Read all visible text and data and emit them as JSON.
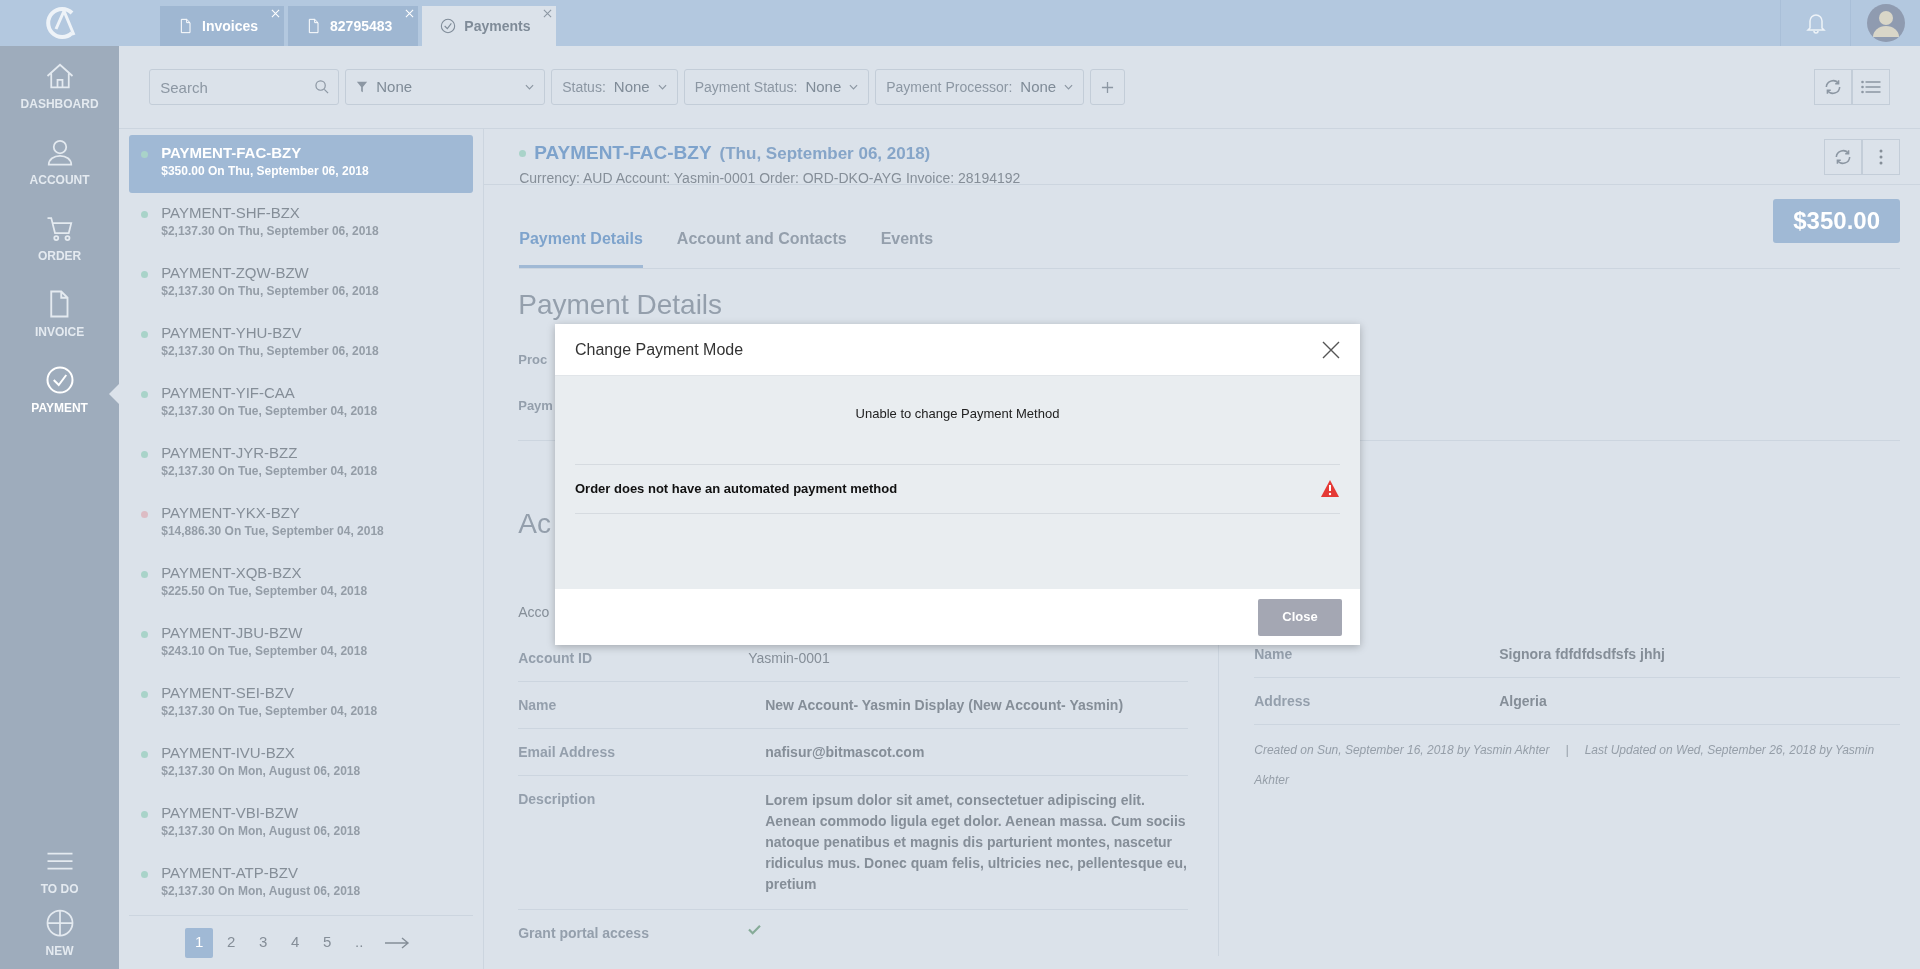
{
  "top_tabs": [
    {
      "label": "Invoices",
      "selected": false
    },
    {
      "label": "82795483",
      "selected": false
    },
    {
      "label": "Payments",
      "selected": true
    }
  ],
  "sidebar": {
    "items": [
      {
        "label": "DASHBOARD",
        "selected": false
      },
      {
        "label": "ACCOUNT",
        "selected": false
      },
      {
        "label": "ORDER",
        "selected": false
      },
      {
        "label": "INVOICE",
        "selected": false
      },
      {
        "label": "PAYMENT",
        "selected": true
      }
    ],
    "bottom_items": [
      {
        "label": "TO DO"
      },
      {
        "label": "NEW"
      }
    ]
  },
  "filters": {
    "search_placeholder": "Search",
    "filter_value": "None",
    "dropdowns": [
      {
        "label": "Status:",
        "value": "None"
      },
      {
        "label": "Payment Status:",
        "value": "None"
      },
      {
        "label": "Payment Processor:",
        "value": "None"
      }
    ]
  },
  "payments": [
    {
      "name": "PAYMENT-FAC-BZY",
      "detail": "$350.00 On Thu, September 06, 2018",
      "color": "#a9d3c9",
      "selected": true
    },
    {
      "name": "PAYMENT-SHF-BZX",
      "detail": "$2,137.30 On Thu, September 06, 2018",
      "color": "#a9d3c9",
      "selected": false
    },
    {
      "name": "PAYMENT-ZQW-BZW",
      "detail": "$2,137.30 On Thu, September 06, 2018",
      "color": "#a9d3c9",
      "selected": false
    },
    {
      "name": "PAYMENT-YHU-BZV",
      "detail": "$2,137.30 On Thu, September 06, 2018",
      "color": "#a9d3c9",
      "selected": false
    },
    {
      "name": "PAYMENT-YIF-CAA",
      "detail": "$2,137.30 On Tue, September 04, 2018",
      "color": "#a9d3c9",
      "selected": false
    },
    {
      "name": "PAYMENT-JYR-BZZ",
      "detail": "$2,137.30 On Tue, September 04, 2018",
      "color": "#a9d3c9",
      "selected": false
    },
    {
      "name": "PAYMENT-YKX-BZY",
      "detail": "$14,886.30 On Tue, September 04, 2018",
      "color": "#dcbcc4",
      "selected": false
    },
    {
      "name": "PAYMENT-XQB-BZX",
      "detail": "$225.50 On Tue, September 04, 2018",
      "color": "#a9d3c9",
      "selected": false
    },
    {
      "name": "PAYMENT-JBU-BZW",
      "detail": "$243.10 On Tue, September 04, 2018",
      "color": "#a9d3c9",
      "selected": false
    },
    {
      "name": "PAYMENT-SEI-BZV",
      "detail": "$2,137.30 On Tue, September 04, 2018",
      "color": "#a9d3c9",
      "selected": false
    },
    {
      "name": "PAYMENT-IVU-BZX",
      "detail": "$2,137.30 On Mon, August 06, 2018",
      "color": "#a9d3c9",
      "selected": false
    },
    {
      "name": "PAYMENT-VBI-BZW",
      "detail": "$2,137.30 On Mon, August 06, 2018",
      "color": "#a9d3c9",
      "selected": false
    },
    {
      "name": "PAYMENT-ATP-BZV",
      "detail": "$2,137.30 On Mon, August 06, 2018",
      "color": "#a9d3c9",
      "selected": false
    }
  ],
  "pagination": {
    "pages": [
      {
        "label": "1",
        "selected": true
      },
      {
        "label": "2",
        "selected": false
      },
      {
        "label": "3",
        "selected": false
      },
      {
        "label": "4",
        "selected": false
      },
      {
        "label": "5",
        "selected": false
      },
      {
        "label": "..",
        "selected": false
      }
    ]
  },
  "detail": {
    "color": "#a9d3c9",
    "title": "PAYMENT-FAC-BZY",
    "date": "(Thu, September 06, 2018)",
    "meta": "Currency: AUD Account: Yasmin-0001 Order: ORD-DKO-AYG Invoice: 28194192",
    "tabs": [
      {
        "label": "Payment Details",
        "selected": true
      },
      {
        "label": "Account and Contacts",
        "selected": false
      },
      {
        "label": "Events",
        "selected": false
      }
    ],
    "amount": "$350.00",
    "section_title": "Payment Details",
    "section_labels": [
      "Proc",
      "Paym"
    ],
    "second_title": "Ac",
    "left_heading": "Acco",
    "left_fields": [
      {
        "label": "Account ID",
        "value": "Yasmin-0001"
      },
      {
        "label": "Name",
        "value": "New Account- Yasmin Display (New Account- Yasmin)"
      },
      {
        "label": "Email Address",
        "value": "nafisur@bitmascot.com"
      },
      {
        "label": "Description",
        "value": "Lorem ipsum dolor sit amet, consectetuer adipiscing elit. Aenean commodo ligula eget dolor. Aenean massa. Cum sociis natoque penatibus et magnis dis parturient montes, nascetur ridiculus mus. Donec quam felis, ultricies nec, pellentesque eu, pretium"
      }
    ],
    "grant_label": "Grant portal access",
    "grant_checked": true,
    "right_fields": [
      {
        "label": "Name",
        "value": "Signora fdfdfdsdfsfs jhhj"
      },
      {
        "label": "Address",
        "value": "Algeria"
      }
    ],
    "created": "Created on Sun, September 16, 2018 by Yasmin Akhter",
    "separator": "|",
    "updated": "Last Updated on Wed, September 26, 2018 by Yasmin Akhter"
  },
  "modal": {
    "title": "Change Payment Mode",
    "message": "Unable to change Payment Method",
    "error": "Order does not have an automated payment method",
    "button": "Close"
  }
}
